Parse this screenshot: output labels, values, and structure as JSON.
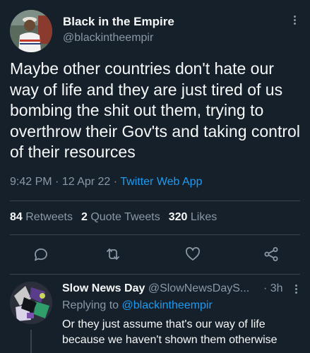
{
  "tweet": {
    "author_name": "Black in the Empire",
    "author_handle": "@blackintheempir",
    "text": "Maybe other countries don't hate our way of life and they are just tired of us bombing the shit out them, trying to overthrow their Gov'ts and taking control of their resources",
    "time": "9:42 PM",
    "date": "12 Apr 22",
    "separator": "·",
    "source": "Twitter Web App",
    "more_icon": "more-vertical-icon"
  },
  "stats": {
    "retweets_count": "84",
    "retweets_label": "Retweets",
    "quotes_count": "2",
    "quotes_label": "Quote Tweets",
    "likes_count": "320",
    "likes_label": "Likes"
  },
  "actions": [
    {
      "name": "reply",
      "icon": "reply-icon"
    },
    {
      "name": "retweet",
      "icon": "retweet-icon"
    },
    {
      "name": "like",
      "icon": "heart-icon"
    },
    {
      "name": "share",
      "icon": "share-icon"
    }
  ],
  "reply": {
    "author_name": "Slow News Day",
    "author_handle": "@SlowNewsDayS...",
    "time": "· 3h",
    "replying_prefix": "Replying to",
    "replying_to": "@blackintheempir",
    "text": "Or they just assume that's our way of life because we haven't shown them otherwise"
  },
  "colors": {
    "background": "#15202b",
    "text_primary": "#f7f9f9",
    "text_secondary": "#8b98a5",
    "accent": "#1d9bf0",
    "divider": "#38444d"
  }
}
